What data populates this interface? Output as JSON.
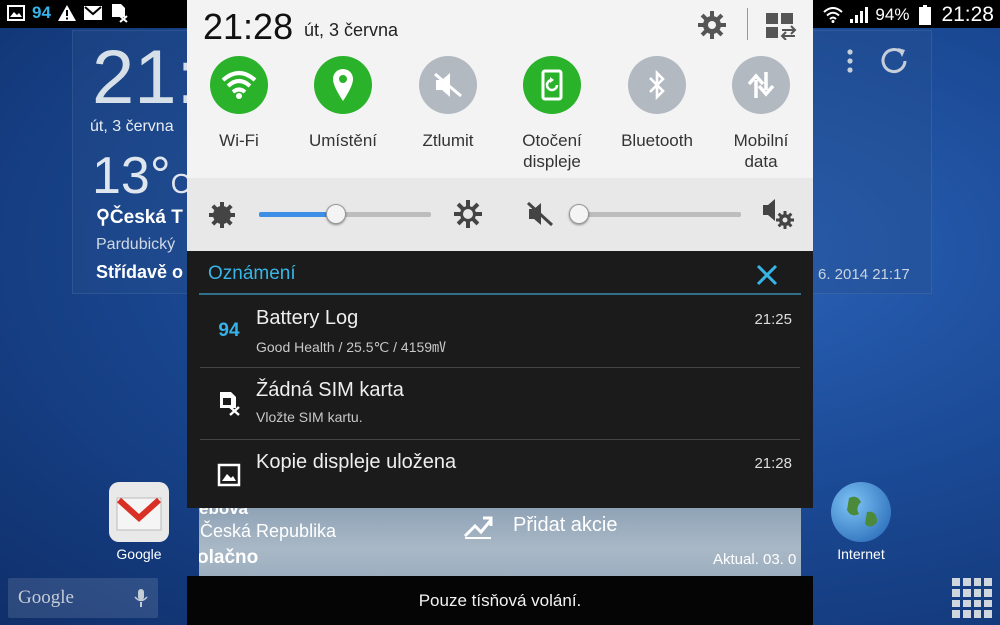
{
  "status_bar": {
    "battery_badge": "94",
    "battery_percent": "94%",
    "time": "21:28"
  },
  "background": {
    "clock": "21:",
    "date": "út, 3 června",
    "temperature": "13°",
    "temp_unit": "C",
    "location": "Česká T",
    "region": "Pardubický",
    "condition": "Střídavě o",
    "updated": "6. 2014 21:17",
    "apps": [
      {
        "label": "Google"
      },
      {
        "label": "Internet"
      }
    ],
    "search_label": "Google"
  },
  "quick_settings": {
    "time": "21:28",
    "date": "út, 3 června",
    "toggles": [
      {
        "label": "Wi-Fi",
        "state": "on",
        "icon": "wifi-icon"
      },
      {
        "label": "Umístění",
        "state": "on",
        "icon": "location-icon"
      },
      {
        "label": "Ztlumit",
        "state": "off",
        "icon": "mute-icon"
      },
      {
        "label": "Otočení displeje",
        "state": "on",
        "icon": "rotate-icon"
      },
      {
        "label": "Bluetooth",
        "state": "off",
        "icon": "bluetooth-icon"
      },
      {
        "label": "Mobilní data",
        "state": "off",
        "icon": "mobile-data-icon"
      }
    ],
    "brightness_level": 0.45,
    "volume_level": 0.0
  },
  "notifications": {
    "title": "Oznámení",
    "items": [
      {
        "icon_text": "94",
        "title": "Battery Log",
        "subtitle": "Good Health / 25.5℃ / 4159㎷",
        "time": "21:25"
      },
      {
        "icon_text": "",
        "title": "Žádná SIM karta",
        "subtitle": "Vložte SIM kartu.",
        "time": ""
      },
      {
        "icon_text": "",
        "title": "Kopie displeje uložena",
        "subtitle": "",
        "time": "21:28"
      }
    ]
  },
  "weather_strip": {
    "top": "ebová",
    "location": "Česká Republika",
    "condition": "olačno",
    "add_stocks": "Přidat akcie",
    "updated": "Aktual. 03. 0"
  },
  "emergency": {
    "text": "Pouze tísňová volání."
  },
  "colors": {
    "accent": "#37b6e6",
    "toggle_on": "#2ab32a",
    "toggle_off": "#b3b9c1"
  }
}
